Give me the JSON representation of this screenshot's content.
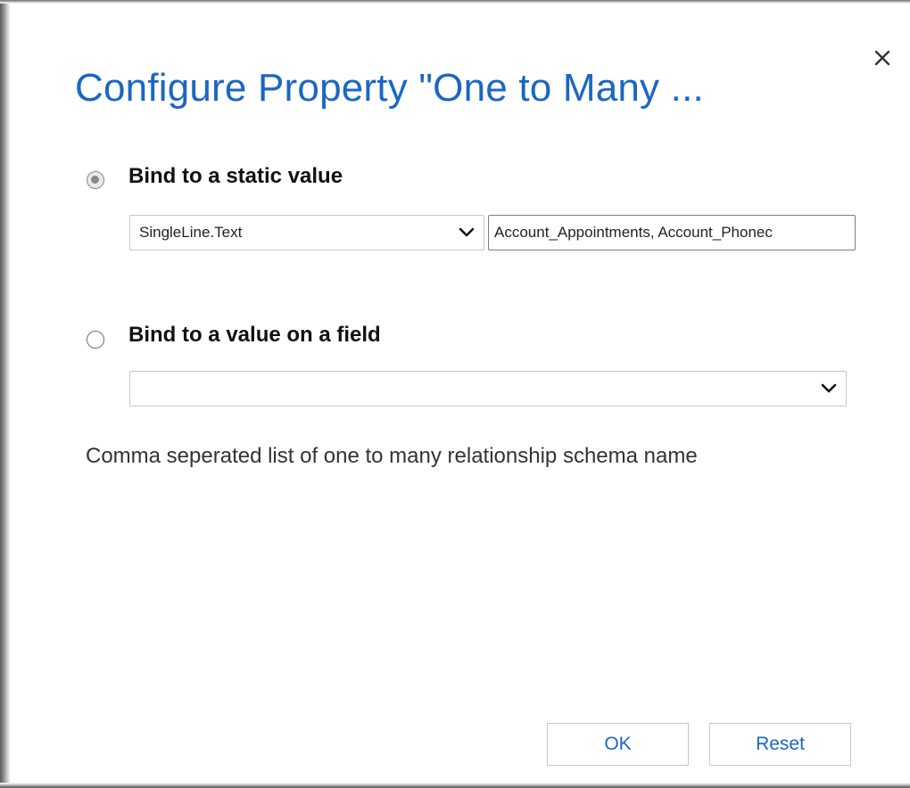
{
  "dialog": {
    "title": "Configure Property \"One to Many ...",
    "close_icon": "close-icon",
    "static_option": {
      "label": "Bind to a static value",
      "checked": true,
      "type_select": {
        "selected": "SingleLine.Text"
      },
      "value_input": {
        "value": "Account_Appointments, Account_Phonec"
      }
    },
    "field_option": {
      "label": "Bind to a value on a field",
      "checked": false,
      "field_select": {
        "selected": ""
      }
    },
    "description": "Comma seperated list of one to many relationship schema name",
    "buttons": {
      "ok_label": "OK",
      "reset_label": "Reset"
    },
    "colors": {
      "accent": "#1a67c4",
      "text": "#111111",
      "border": "#c7c7c7"
    }
  }
}
